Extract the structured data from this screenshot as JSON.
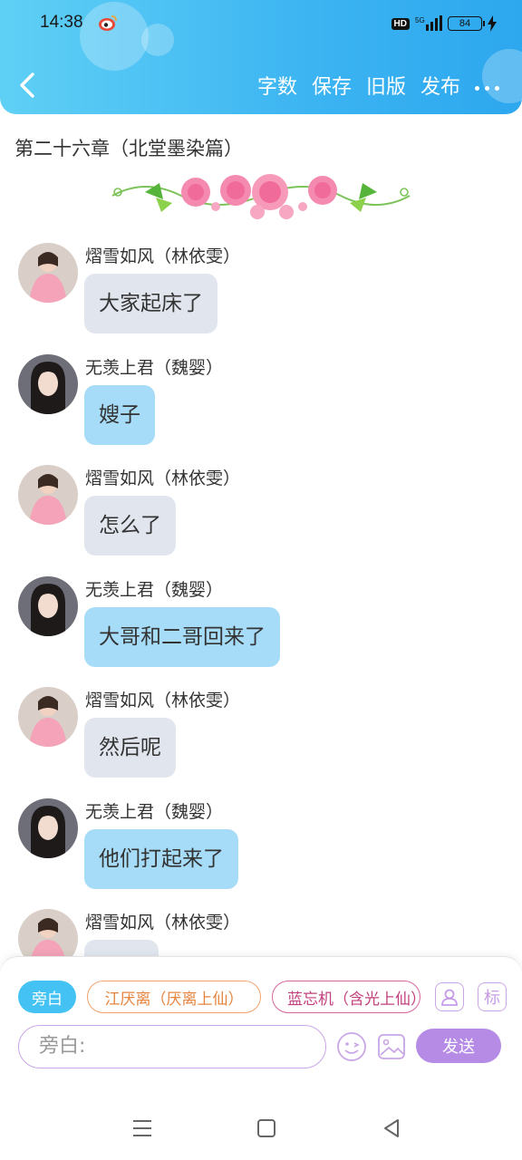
{
  "status_bar": {
    "time": "14:38",
    "network": "5G",
    "hd": "HD",
    "battery": "84"
  },
  "header": {
    "actions": [
      {
        "label": "字数"
      },
      {
        "label": "保存"
      },
      {
        "label": "旧版"
      },
      {
        "label": "发布"
      }
    ],
    "more_icon": "more-dots-icon",
    "back_icon": "chevron-left-icon"
  },
  "chapter": {
    "title": "第二十六章（北堂墨染篇）"
  },
  "messages": [
    {
      "sender": "熠雪如风（林依雯）",
      "text": "大家起床了",
      "side": "grey"
    },
    {
      "sender": "无羡上君（魏婴）",
      "text": "嫂子",
      "side": "blue"
    },
    {
      "sender": "熠雪如风（林依雯）",
      "text": "怎么了",
      "side": "grey"
    },
    {
      "sender": "无羡上君（魏婴）",
      "text": "大哥和二哥回来了",
      "side": "blue"
    },
    {
      "sender": "熠雪如风（林依雯）",
      "text": "然后呢",
      "side": "grey"
    },
    {
      "sender": "无羡上君（魏婴）",
      "text": "他们打起来了",
      "side": "blue"
    },
    {
      "sender": "熠雪如风（林依雯）",
      "text": "",
      "side": "grey"
    }
  ],
  "composer": {
    "roles": [
      {
        "label": "旁白"
      },
      {
        "label": "江厌离（厌离上仙）"
      },
      {
        "label": "蓝忘机（含光上仙）"
      }
    ],
    "mark_label": "标",
    "input_placeholder": "旁白:",
    "send_label": "发送"
  },
  "colors": {
    "header_start": "#5fd0f5",
    "header_end": "#2da7ee",
    "bubble_grey": "#e1e6ee",
    "bubble_blue": "#a6dcf8",
    "accent_purple": "#b58be6"
  }
}
